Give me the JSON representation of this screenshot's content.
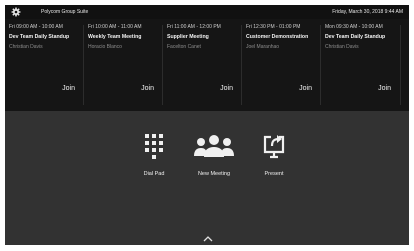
{
  "topbar": {
    "room_name": "Polycom Group Suite",
    "datetime": "Friday, March 30, 2018   9:44 AM",
    "settings_icon": "gear-icon"
  },
  "meetings": [
    {
      "time": "Fri 09:00 AM - 10:00 AM",
      "title": "Dev Team Daily Standup",
      "organizer": "Christian Davis",
      "join_label": "Join"
    },
    {
      "time": "Fri 10:00 AM - 11:00 AM",
      "title": "Weekly Team Meeting",
      "organizer": "Horacio Blanco",
      "join_label": "Join"
    },
    {
      "time": "Fri 11:00 AM - 12:00 PM",
      "title": "Supplier Meeting",
      "organizer": "Facelton Canet",
      "join_label": "Join"
    },
    {
      "time": "Fri 12:30 PM - 01:00 PM",
      "title": "Customer Demonstration",
      "organizer": "Joel Maranhao",
      "join_label": "Join"
    },
    {
      "time": "Mon 09:30 AM - 10:00 AM",
      "title": "Dev Team Daily Standup",
      "organizer": "Christian Davis",
      "join_label": "Join"
    }
  ],
  "actions": {
    "dial_pad": {
      "label": "Dial Pad",
      "icon": "dialpad-icon"
    },
    "new_meeting": {
      "label": "New Meeting",
      "icon": "people-icon"
    },
    "present": {
      "label": "Present",
      "icon": "present-icon"
    }
  },
  "colors": {
    "screen_bg": "#323232",
    "topbar_bg": "#111111",
    "cards_bg": "#151515",
    "text": "#f2f2f2"
  }
}
